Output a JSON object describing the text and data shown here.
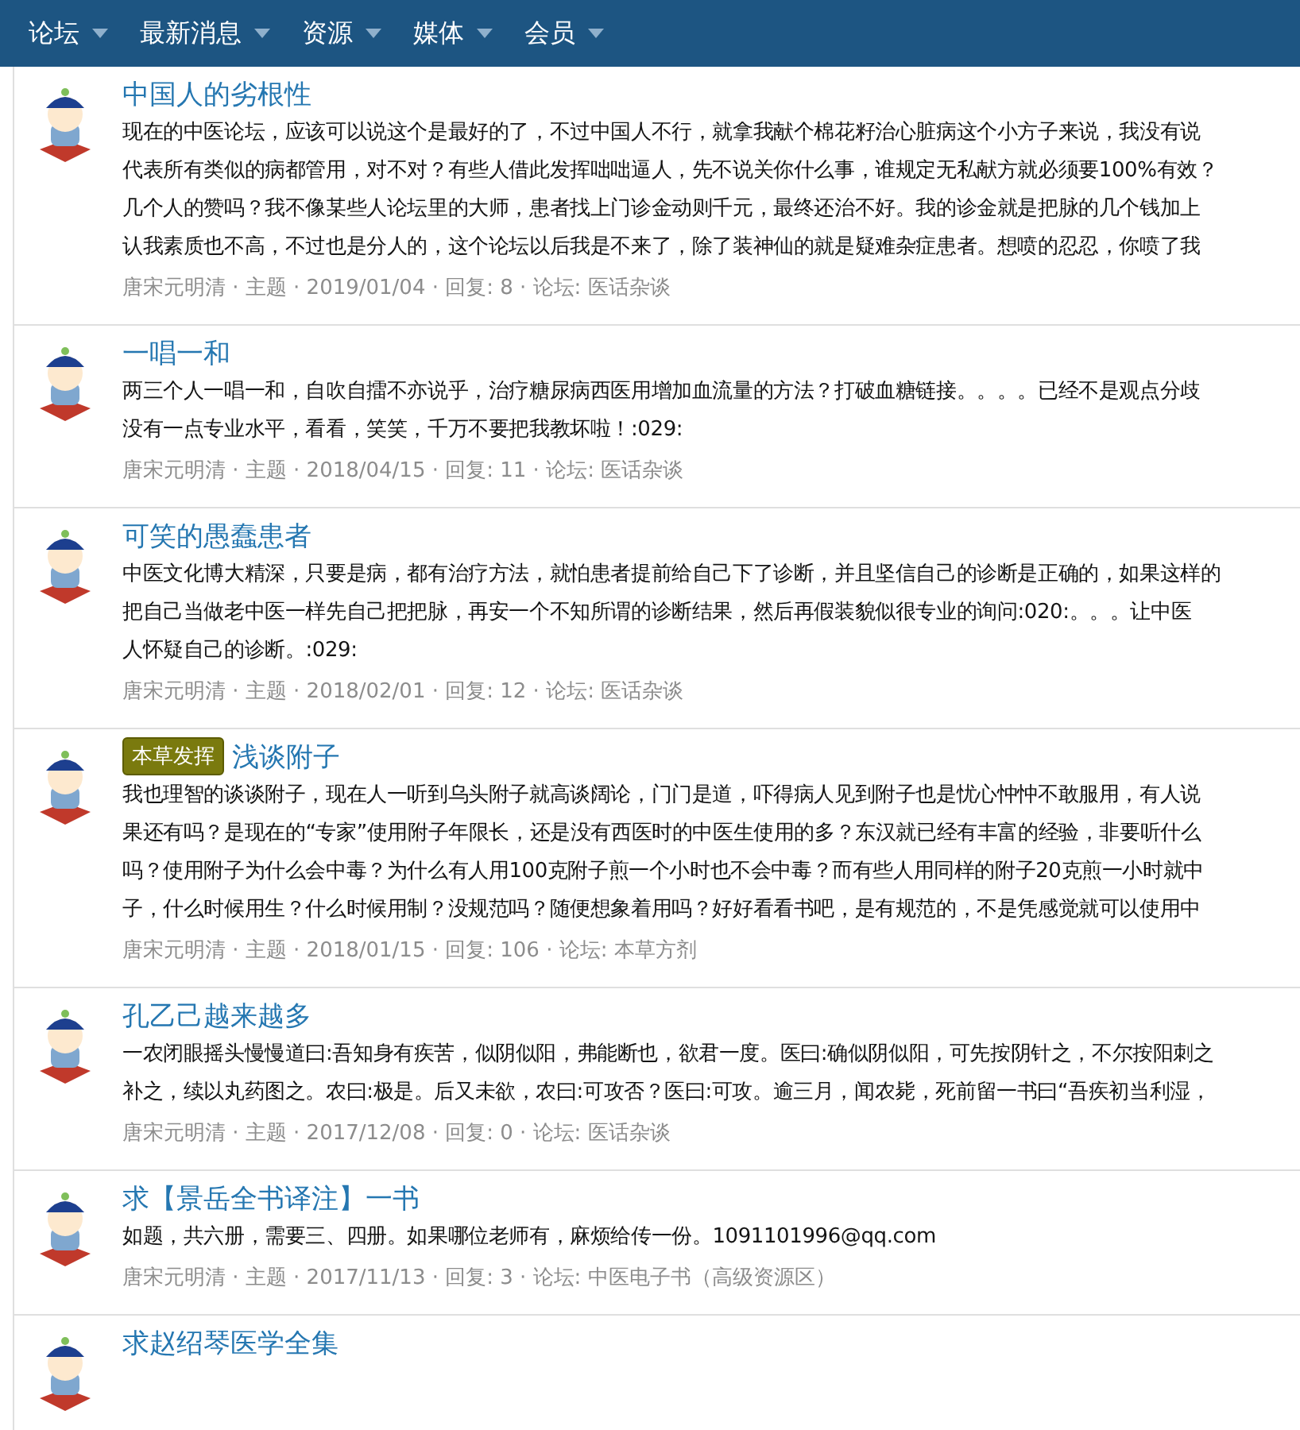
{
  "nav": [
    {
      "label": "论坛"
    },
    {
      "label": "最新消息"
    },
    {
      "label": "资源"
    },
    {
      "label": "媒体"
    },
    {
      "label": "会员"
    }
  ],
  "threads": [
    {
      "title": "中国人的劣根性",
      "lines": [
        "现在的中医论坛，应该可以说这个是最好的了，不过中国人不行，就拿我献个棉花籽治心脏病这个小方子来说，我没有说",
        "代表所有类似的病都管用，对不对？有些人借此发挥咄咄逼人，先不说关你什么事，谁规定无私献方就必须要100%有效？",
        "几个人的赞吗？我不像某些人论坛里的大师，患者找上门诊金动则千元，最终还治不好。我的诊金就是把脉的几个钱加上",
        "认我素质也不高，不过也是分人的，这个论坛以后我是不来了，除了装神仙的就是疑难杂症患者。想喷的忍忍，你喷了我"
      ],
      "meta": "唐宋元明清 · 主题 · 2019/01/04 · 回复: 8 · 论坛: 医话杂谈"
    },
    {
      "title": "一唱一和",
      "lines": [
        "两三个人一唱一和，自吹自擂不亦说乎，治疗糖尿病西医用增加血流量的方法？打破血糖链接。。。。已经不是观点分歧",
        "没有一点专业水平，看看，笑笑，千万不要把我教坏啦！:029:"
      ],
      "meta": "唐宋元明清 · 主题 · 2018/04/15 · 回复: 11 · 论坛: 医话杂谈"
    },
    {
      "title": "可笑的愚蠢患者",
      "lines": [
        "中医文化博大精深，只要是病，都有治疗方法，就怕患者提前给自己下了诊断，并且坚信自己的诊断是正确的，如果这样的",
        "把自己当做老中医一样先自己把把脉，再安一个不知所谓的诊断结果，然后再假装貌似很专业的询问:020:。。。让中医",
        "人怀疑自己的诊断。:029:"
      ],
      "meta": "唐宋元明清 · 主题 · 2018/02/01 · 回复: 12 · 论坛: 医话杂谈"
    },
    {
      "prefix": "本草发挥",
      "title": "浅谈附子",
      "lines": [
        "我也理智的谈谈附子，现在人一听到乌头附子就高谈阔论，门门是道，吓得病人见到附子也是忧心忡忡不敢服用，有人说",
        "果还有吗？是现在的“专家”使用附子年限长，还是没有西医时的中医生使用的多？东汉就已经有丰富的经验，非要听什么",
        "吗？使用附子为什么会中毒？为什么有人用100克附子煎一个小时也不会中毒？而有些人用同样的附子20克煎一小时就中",
        "子，什么时候用生？什么时候用制？没规范吗？随便想象着用吗？好好看看书吧，是有规范的，不是凭感觉就可以使用中"
      ],
      "meta": "唐宋元明清 · 主题 · 2018/01/15 · 回复: 106 · 论坛: 本草方剂"
    },
    {
      "title": "孔乙己越来越多",
      "lines": [
        "一农闭眼摇头慢慢道曰:吾知身有疾苦，似阴似阳，弗能断也，欲君一度。医曰:确似阴似阳，可先按阴针之，不尔按阳刺之",
        "补之，续以丸药图之。农曰:极是。后又未欲，农曰:可攻否？医曰:可攻。逾三月，闻农毙，死前留一书曰“吾疾初当利湿，"
      ],
      "meta": "唐宋元明清 · 主题 · 2017/12/08 · 回复: 0 · 论坛: 医话杂谈"
    },
    {
      "title": "求【景岳全书译注】一书",
      "lines": [
        "如题，共六册，需要三、四册。如果哪位老师有，麻烦给传一份。1091101996@qq.com"
      ],
      "meta": "唐宋元明清 · 主题 · 2017/11/13 · 回复: 3 · 论坛: 中医电子书（高级资源区）"
    },
    {
      "title": "求赵绍琴医学全集"
    }
  ]
}
